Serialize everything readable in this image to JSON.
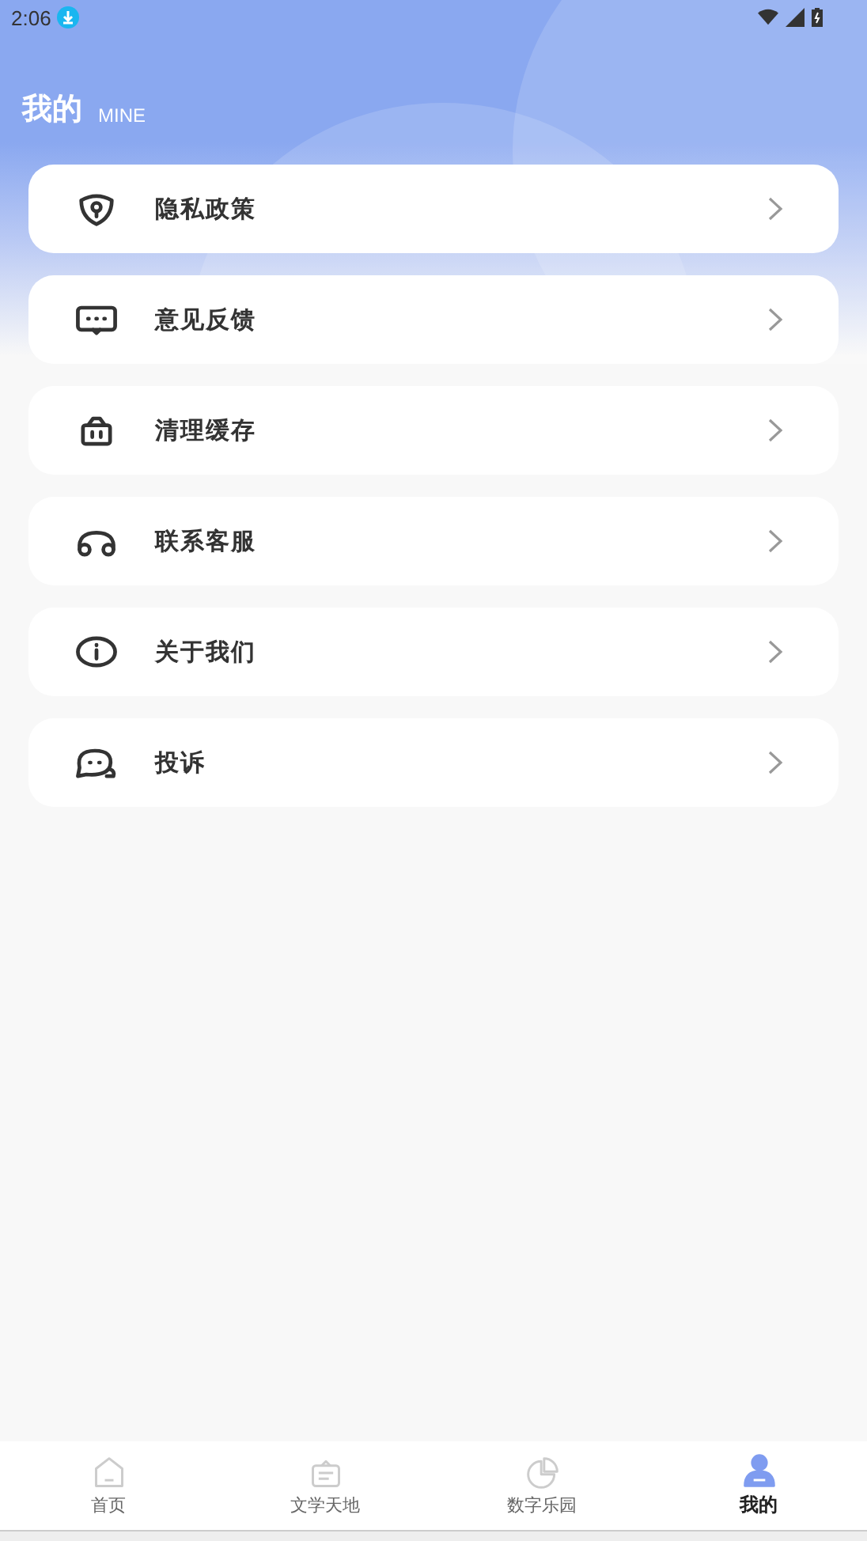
{
  "status_bar": {
    "time": "2:06"
  },
  "header": {
    "title": "我的",
    "subtitle": "MINE"
  },
  "menu": [
    {
      "kind": "shield",
      "label": "隐私政策"
    },
    {
      "kind": "message",
      "label": "意见反馈"
    },
    {
      "kind": "basket",
      "label": "清理缓存"
    },
    {
      "kind": "headset",
      "label": "联系客服"
    },
    {
      "kind": "info",
      "label": "关于我们"
    },
    {
      "kind": "chat",
      "label": "投诉"
    }
  ],
  "tabs": [
    {
      "kind": "home",
      "label": "首页",
      "selected": false
    },
    {
      "kind": "literature",
      "label": "文学天地",
      "selected": false
    },
    {
      "kind": "chart",
      "label": "数字乐园",
      "selected": false
    },
    {
      "kind": "person",
      "label": "我的",
      "selected": true
    }
  ]
}
